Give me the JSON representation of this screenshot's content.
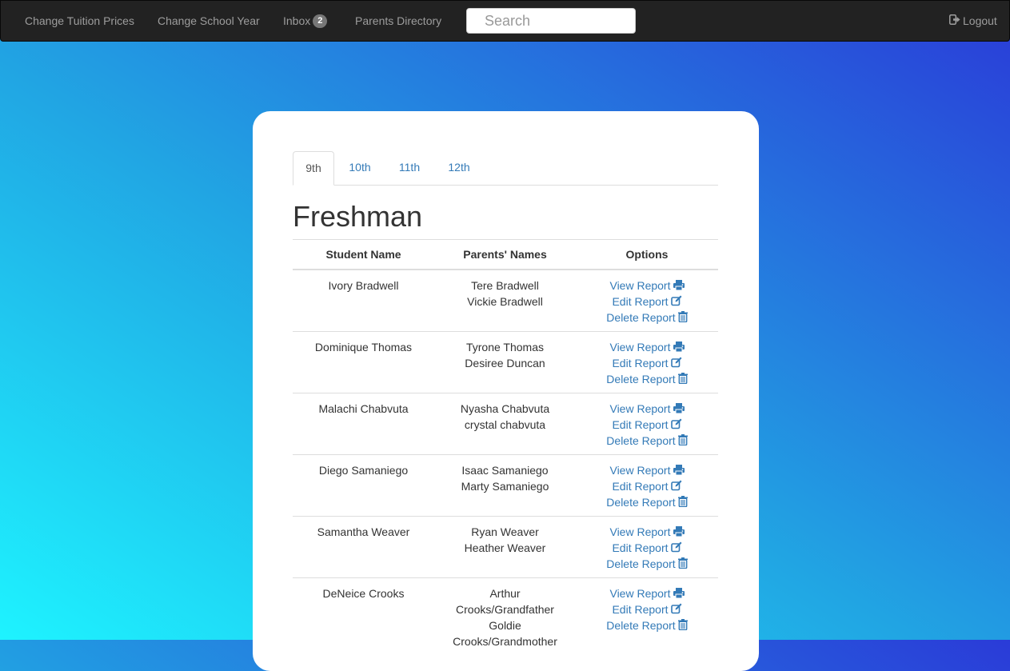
{
  "nav": {
    "tuition": "Change Tuition Prices",
    "school_year": "Change School Year",
    "inbox": "Inbox",
    "inbox_count": "2",
    "parents_directory": "Parents Directory",
    "search_placeholder": "Search",
    "logout": "Logout"
  },
  "tabs": [
    "9th",
    "10th",
    "11th",
    "12th"
  ],
  "heading": "Freshman",
  "table": {
    "headers": [
      "Student Name",
      "Parents' Names",
      "Options"
    ],
    "options": {
      "view": "View Report",
      "edit": "Edit Report",
      "delete": "Delete Report"
    },
    "rows": [
      {
        "student": "Ivory Bradwell",
        "parents": [
          "Tere Bradwell",
          "Vickie Bradwell"
        ]
      },
      {
        "student": "Dominique Thomas",
        "parents": [
          "Tyrone Thomas",
          "Desiree Duncan"
        ]
      },
      {
        "student": "Malachi Chabvuta",
        "parents": [
          "Nyasha Chabvuta",
          "crystal chabvuta"
        ]
      },
      {
        "student": "Diego Samaniego",
        "parents": [
          "Isaac Samaniego",
          "Marty Samaniego"
        ]
      },
      {
        "student": "Samantha Weaver",
        "parents": [
          "Ryan Weaver",
          "Heather Weaver"
        ]
      },
      {
        "student": "DeNeice Crooks",
        "parents": [
          "Arthur",
          "Crooks/Grandfather",
          "Goldie",
          "Crooks/Grandmother"
        ]
      }
    ]
  },
  "icons": {
    "view": "print-icon",
    "edit": "edit-icon",
    "delete": "trash-icon",
    "logout": "logout-icon"
  },
  "colors": {
    "link": "#337ab7",
    "navbar": "#222222",
    "gradient_start": "#1ef3ff",
    "gradient_end": "#2a3bd8"
  }
}
